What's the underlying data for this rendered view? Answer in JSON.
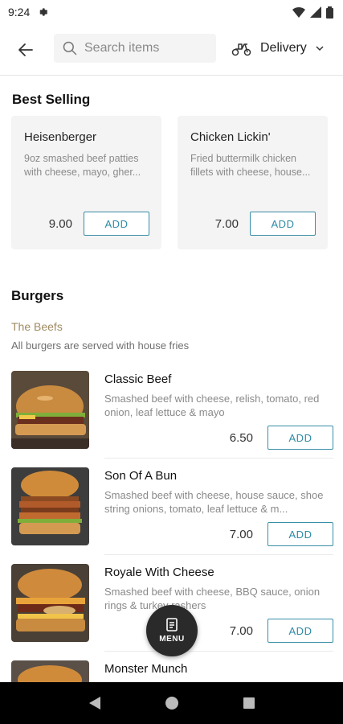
{
  "status_bar": {
    "time": "9:24"
  },
  "header": {
    "search_placeholder": "Search items",
    "delivery_label": "Delivery"
  },
  "best_selling": {
    "title": "Best Selling",
    "items": [
      {
        "name": "Heisenberger",
        "desc": "9oz smashed beef patties with cheese, mayo, gher...",
        "price": "9.00",
        "add": "ADD"
      },
      {
        "name": "Chicken Lickin'",
        "desc": "Fried buttermilk chicken fillets with cheese, house...",
        "price": "7.00",
        "add": "ADD"
      }
    ]
  },
  "burgers": {
    "title": "Burgers",
    "subcategory": "The Beefs",
    "note": "All burgers are served with house fries",
    "items": [
      {
        "name": "Classic Beef",
        "desc": "Smashed beef with cheese, relish, tomato, red onion, leaf lettuce & mayo",
        "price": "6.50",
        "add": "ADD"
      },
      {
        "name": "Son Of A Bun",
        "desc": "Smashed beef with cheese, house sauce, shoe string onions, tomato, leaf lettuce & m...",
        "price": "7.00",
        "add": "ADD"
      },
      {
        "name": "Royale With Cheese",
        "desc": "Smashed beef with cheese, BBQ sauce, onion rings & turkey rashers",
        "price": "7.00",
        "add": "ADD"
      },
      {
        "name": "Monster Munch"
      }
    ]
  },
  "menu_fab": {
    "label": "MENU"
  },
  "colors": {
    "accent": "#2e8aa5",
    "subcategory": "#a08b61",
    "card_bg": "#f4f4f4"
  }
}
